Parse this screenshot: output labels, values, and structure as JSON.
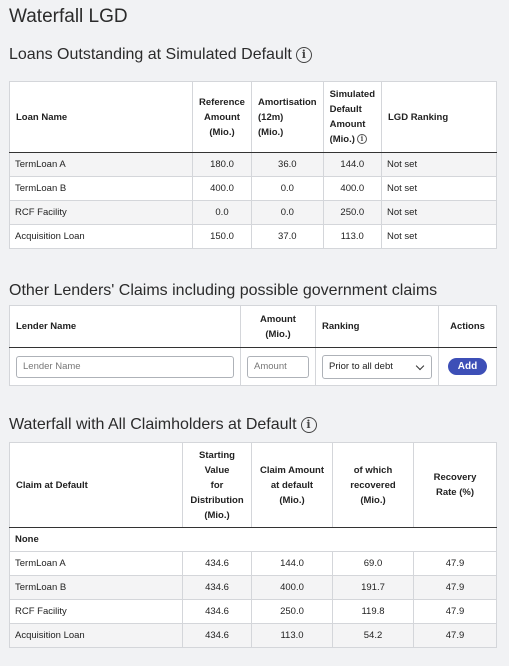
{
  "page_title": "Waterfall LGD",
  "loans": {
    "title": "Loans Outstanding at Simulated Default",
    "headers": {
      "name": "Loan Name",
      "ref_amount": [
        "Reference",
        "Amount",
        "(Mio.)"
      ],
      "amortisation": [
        "Amortisation",
        "(12m)",
        "(Mio.)"
      ],
      "sim_default": [
        "Simulated",
        "Default",
        "Amount",
        "(Mio.)"
      ],
      "ranking": "LGD Ranking"
    },
    "rows": [
      {
        "name": "TermLoan A",
        "ref": "180.0",
        "amort": "36.0",
        "sim": "144.0",
        "rank": "Not set"
      },
      {
        "name": "TermLoan B",
        "ref": "400.0",
        "amort": "0.0",
        "sim": "400.0",
        "rank": "Not set"
      },
      {
        "name": "RCF Facility",
        "ref": "0.0",
        "amort": "0.0",
        "sim": "250.0",
        "rank": "Not set"
      },
      {
        "name": "Acquisition Loan",
        "ref": "150.0",
        "amort": "37.0",
        "sim": "113.0",
        "rank": "Not set"
      }
    ]
  },
  "lenders": {
    "title": "Other Lenders' Claims including possible government claims",
    "headers": {
      "name": "Lender Name",
      "amount": [
        "Amount",
        "(Mio.)"
      ],
      "ranking": "Ranking",
      "actions": "Actions"
    },
    "name_placeholder": "Lender Name",
    "amount_placeholder": "Amount",
    "ranking_value": "Prior to all debt",
    "add_label": "Add"
  },
  "waterfall": {
    "title": "Waterfall with All Claimholders at Default",
    "headers": {
      "claim": "Claim at Default",
      "starting": [
        "Starting",
        "Value",
        "for",
        "Distribution",
        "(Mio.)"
      ],
      "claim_amount": [
        "Claim Amount",
        "at default",
        "(Mio.)"
      ],
      "recovered": [
        "of which",
        "recovered",
        "(Mio.)"
      ],
      "recovery_rate": [
        "Recovery",
        "Rate (%)"
      ]
    },
    "group_label": "None",
    "rows": [
      {
        "name": "TermLoan A",
        "start": "434.6",
        "claim": "144.0",
        "rec": "69.0",
        "rate": "47.9"
      },
      {
        "name": "TermLoan B",
        "start": "434.6",
        "claim": "400.0",
        "rec": "191.7",
        "rate": "47.9"
      },
      {
        "name": "RCF Facility",
        "start": "434.6",
        "claim": "250.0",
        "rec": "119.8",
        "rate": "47.9"
      },
      {
        "name": "Acquisition Loan",
        "start": "434.6",
        "claim": "113.0",
        "rec": "54.2",
        "rate": "47.9"
      }
    ]
  }
}
